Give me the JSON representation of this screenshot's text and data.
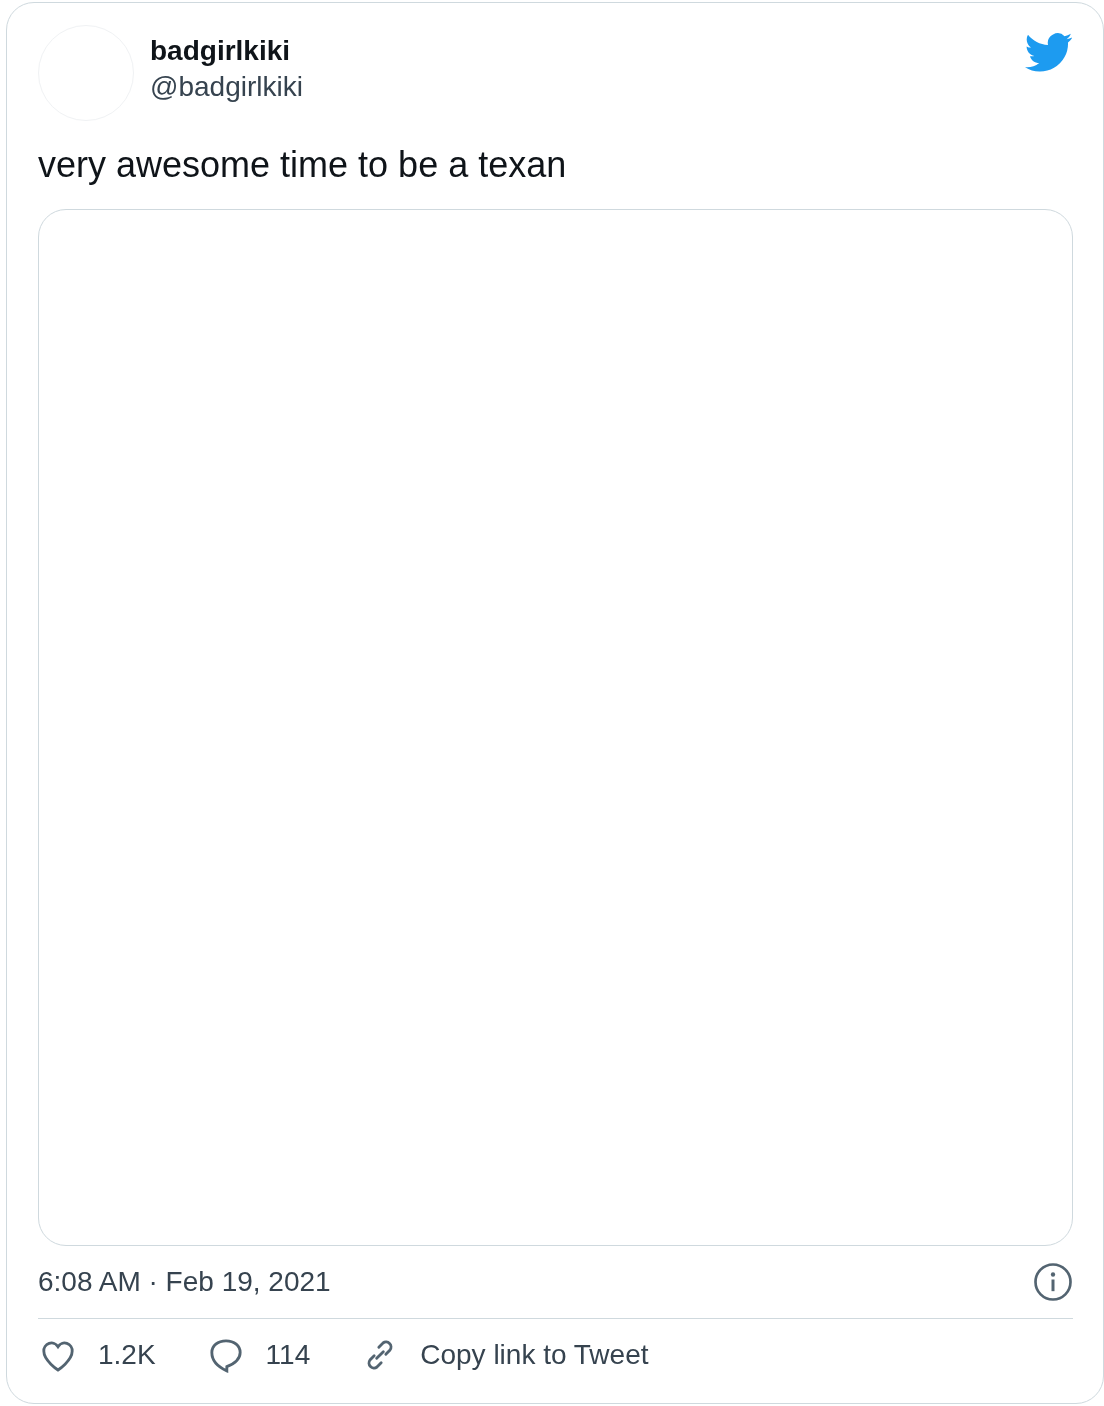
{
  "author": {
    "name": "badgirlkiki",
    "handle": "@badgirlkiki"
  },
  "text": "very awesome time to be a texan",
  "timestamp": "6:08 AM · Feb 19, 2021",
  "actions": [
    {
      "kind": "like",
      "label": "1.2K"
    },
    {
      "kind": "reply",
      "label": "114"
    },
    {
      "kind": "copy",
      "label": "Copy link to Tweet"
    }
  ]
}
